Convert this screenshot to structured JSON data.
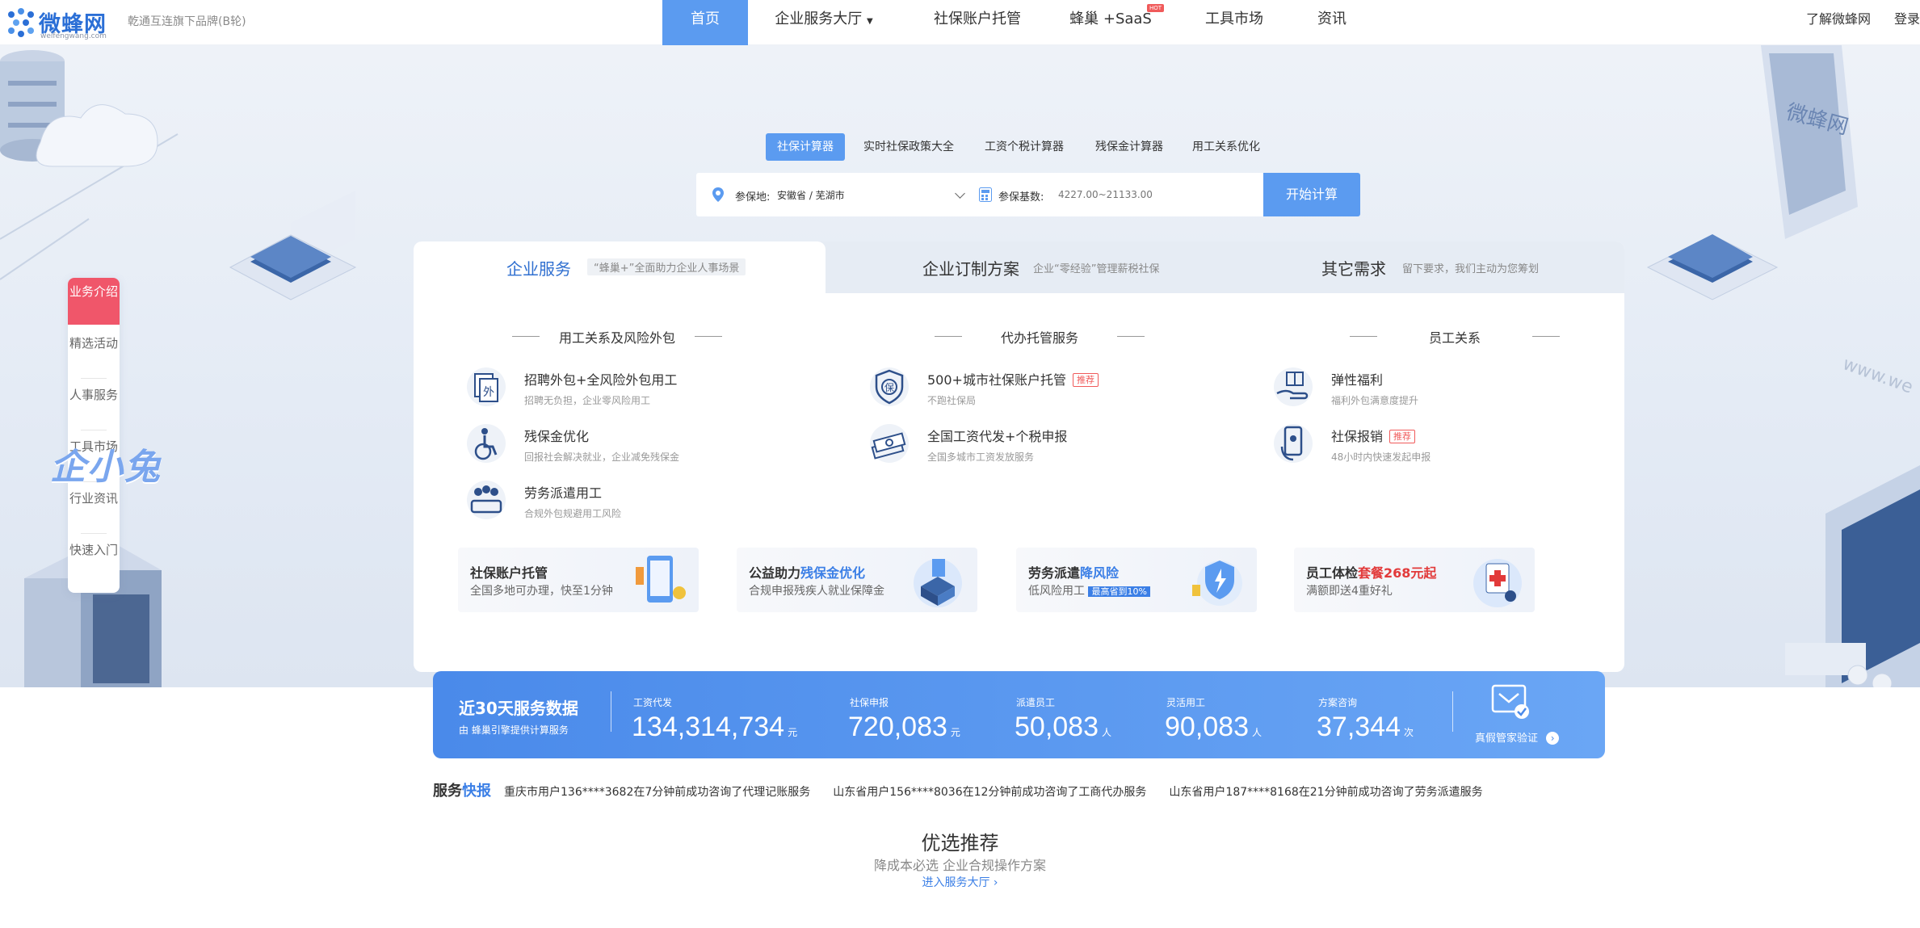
{
  "brand": {
    "logo_name": "微蜂网",
    "logo_url": "weifengwang.com",
    "sub": "乾通互连旗下品牌(B轮)"
  },
  "nav": {
    "items": [
      "首页",
      "企业服务大厅",
      "社保账户托管",
      "蜂巢 +SaaS",
      "工具市场",
      "资讯"
    ],
    "hot_badge": "HOT",
    "about": "了解微蜂网",
    "login": "登录"
  },
  "calc_tabs": [
    "社保计算器",
    "实时社保政策大全",
    "工资个税计算器",
    "残保金计算器",
    "用工关系优化"
  ],
  "search": {
    "loc_label": "参保地:",
    "loc_value": "安徽省 / 芜湖市",
    "base_label": "参保基数:",
    "base_placeholder": "4227.00~21133.00",
    "button": "开始计算"
  },
  "side_nav": [
    "业务介绍",
    "精选活动",
    "人事服务",
    "工具市场",
    "行业资讯",
    "快速入门"
  ],
  "mascot_text": "企小兔",
  "card": {
    "tabs": [
      {
        "title": "企业服务",
        "sub": "“蜂巢+”全面助力企业人事场景"
      },
      {
        "title": "企业订制方案",
        "sub": "企业“零经验”管理薪税社保"
      },
      {
        "title": "其它需求",
        "sub": "留下要求，我们主动为您筹划"
      }
    ],
    "columns": [
      {
        "heading": "用工关系及风险外包",
        "items": [
          {
            "title": "招聘外包+全风险外包用工",
            "desc": "招聘无负担，企业零风险用工",
            "tag": "",
            "icon": "outsource-icon"
          },
          {
            "title": "残保金优化",
            "desc": "回报社会解决就业，企业减免残保金",
            "tag": "",
            "icon": "wheelchair-icon"
          },
          {
            "title": "劳务派遣用工",
            "desc": "合规外包规避用工风险",
            "tag": "",
            "icon": "meeting-icon"
          }
        ]
      },
      {
        "heading": "代办托管服务",
        "items": [
          {
            "title": "500+城市社保账户托管",
            "desc": "不跑社保局",
            "tag": "推荐",
            "icon": "shield-icon"
          },
          {
            "title": "全国工资代发+个税申报",
            "desc": "全国多城市工资发放服务",
            "tag": "",
            "icon": "money-icon"
          }
        ]
      },
      {
        "heading": "员工关系",
        "items": [
          {
            "title": "弹性福利",
            "desc": "福利外包满意度提升",
            "tag": "",
            "icon": "gift-icon"
          },
          {
            "title": "社保报销",
            "desc": "48小时内快速发起申报",
            "tag": "推荐",
            "icon": "phone-icon"
          }
        ]
      }
    ],
    "promos": [
      {
        "title_a": "社保账户托管",
        "title_hl": "",
        "title_rd": "",
        "desc": "全国多地可办理，快至1分钟",
        "badge": ""
      },
      {
        "title_a": "公益助力",
        "title_hl": "残保金优化",
        "title_rd": "",
        "desc": "合规申报残疾人就业保障金",
        "badge": ""
      },
      {
        "title_a": "劳务派遣",
        "title_hl": "降风险",
        "title_rd": "",
        "desc": "低风险用工",
        "badge": "最高省到10%"
      },
      {
        "title_a": "员工体检",
        "title_hl": "",
        "title_rd": "套餐268元起",
        "desc": "满额即送4重好礼",
        "badge": ""
      }
    ]
  },
  "stats": {
    "title": "近30天服务数据",
    "sub": "由 蜂巢引擎提供计算服务",
    "items": [
      {
        "label": "工资代发",
        "value": "134,314,734",
        "unit": "元"
      },
      {
        "label": "社保申报",
        "value": "720,083",
        "unit": "元"
      },
      {
        "label": "派遣员工",
        "value": "50,083",
        "unit": "人"
      },
      {
        "label": "灵活用工",
        "value": "90,083",
        "unit": "人"
      },
      {
        "label": "方案咨询",
        "value": "37,344",
        "unit": "次"
      }
    ],
    "verify": "真假管家验证"
  },
  "ticker": {
    "title_a": "服务",
    "title_b": "快报",
    "lines": [
      "重庆市用户136****3682在7分钟前成功咨询了代理记账服务　　山东省用户156****8036在12分钟前成功咨询了工商代办服务　　山东省用户187****8168在21分钟前成功咨询了劳务派遣服务"
    ]
  },
  "recommend": {
    "title": "优选推荐",
    "sub": "降成本必选 企业合规操作方案",
    "link": "进入服务大厅 ›"
  },
  "colors": {
    "primary": "#5b9bf0",
    "accent_red": "#f0566a",
    "stats_bg": "#4a8aea"
  }
}
